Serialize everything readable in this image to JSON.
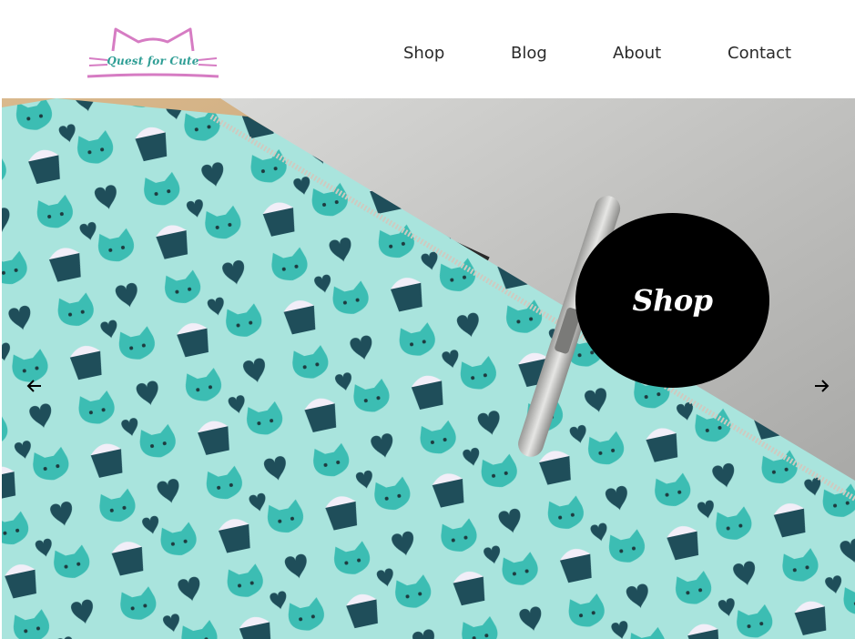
{
  "brand": {
    "logo_text": "Quest for Cute",
    "logo_color": "#d67cc3",
    "text_color": "#2f9e95"
  },
  "nav": {
    "items": [
      {
        "label": "Shop"
      },
      {
        "label": "Blog"
      },
      {
        "label": "About"
      },
      {
        "label": "Contact"
      }
    ]
  },
  "hero": {
    "cta_label": "Shop",
    "prev_icon": "arrow-left-icon",
    "next_icon": "arrow-right-icon"
  },
  "colors": {
    "accent_teal": "#3cbdb3",
    "pouch_bg": "#a9e4dd",
    "navy": "#1f4e5a",
    "cta_bg": "#000000"
  }
}
